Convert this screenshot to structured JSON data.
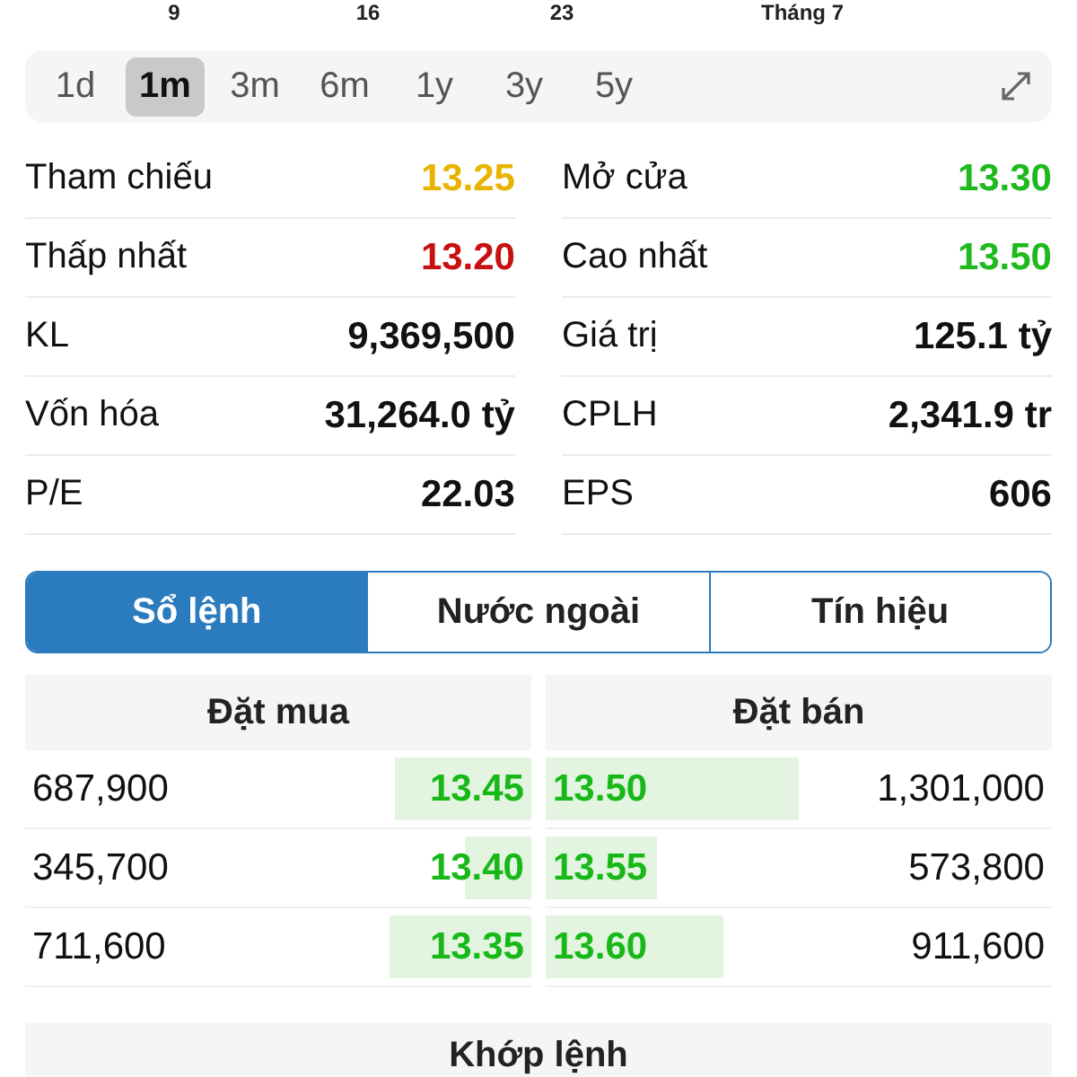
{
  "chart_axis": [
    {
      "label": "9"
    },
    {
      "label": "16"
    },
    {
      "label": "23"
    },
    {
      "label": "Tháng 7"
    }
  ],
  "periods": [
    {
      "label": "1d",
      "selected": false
    },
    {
      "label": "1m",
      "selected": true
    },
    {
      "label": "3m",
      "selected": false
    },
    {
      "label": "6m",
      "selected": false
    },
    {
      "label": "1y",
      "selected": false
    },
    {
      "label": "3y",
      "selected": false
    },
    {
      "label": "5y",
      "selected": false
    }
  ],
  "stats": [
    {
      "label": "Tham chiếu",
      "value": "13.25",
      "color": "#e8b400"
    },
    {
      "label": "Mở cửa",
      "value": "13.30",
      "color": "#1db91d"
    },
    {
      "label": "Thấp nhất",
      "value": "13.20",
      "color": "#c81010"
    },
    {
      "label": "Cao nhất",
      "value": "13.50",
      "color": "#1db91d"
    },
    {
      "label": "KL",
      "value": "9,369,500",
      "color": "#111111"
    },
    {
      "label": "Giá trị",
      "value": "125.1 tỷ",
      "color": "#111111"
    },
    {
      "label": "Vốn hóa",
      "value": "31,264.0 tỷ",
      "color": "#111111"
    },
    {
      "label": "CPLH",
      "value": "2,341.9 tr",
      "color": "#111111"
    },
    {
      "label": "P/E",
      "value": "22.03",
      "color": "#111111"
    },
    {
      "label": "EPS",
      "value": "606",
      "color": "#111111"
    }
  ],
  "segments": [
    {
      "label": "Sổ lệnh",
      "selected": true
    },
    {
      "label": "Nước ngoài",
      "selected": false
    },
    {
      "label": "Tín hiệu",
      "selected": false
    }
  ],
  "order_book": {
    "bid_title": "Đặt mua",
    "ask_title": "Đặt bán",
    "rows": [
      {
        "bid": {
          "volume": "687,900",
          "price": "13.45",
          "level": 0.27
        },
        "ask": {
          "price": "13.50",
          "level": 0.5,
          "volume": "1,301,000"
        }
      },
      {
        "bid": {
          "volume": "345,700",
          "price": "13.40",
          "level": 0.13
        },
        "ask": {
          "price": "13.55",
          "level": 0.22,
          "volume": "573,800"
        }
      },
      {
        "bid": {
          "volume": "711,600",
          "price": "13.35",
          "level": 0.28
        },
        "ask": {
          "price": "13.60",
          "level": 0.35,
          "volume": "911,600"
        }
      }
    ]
  },
  "matched_title": "Khớp lệnh"
}
